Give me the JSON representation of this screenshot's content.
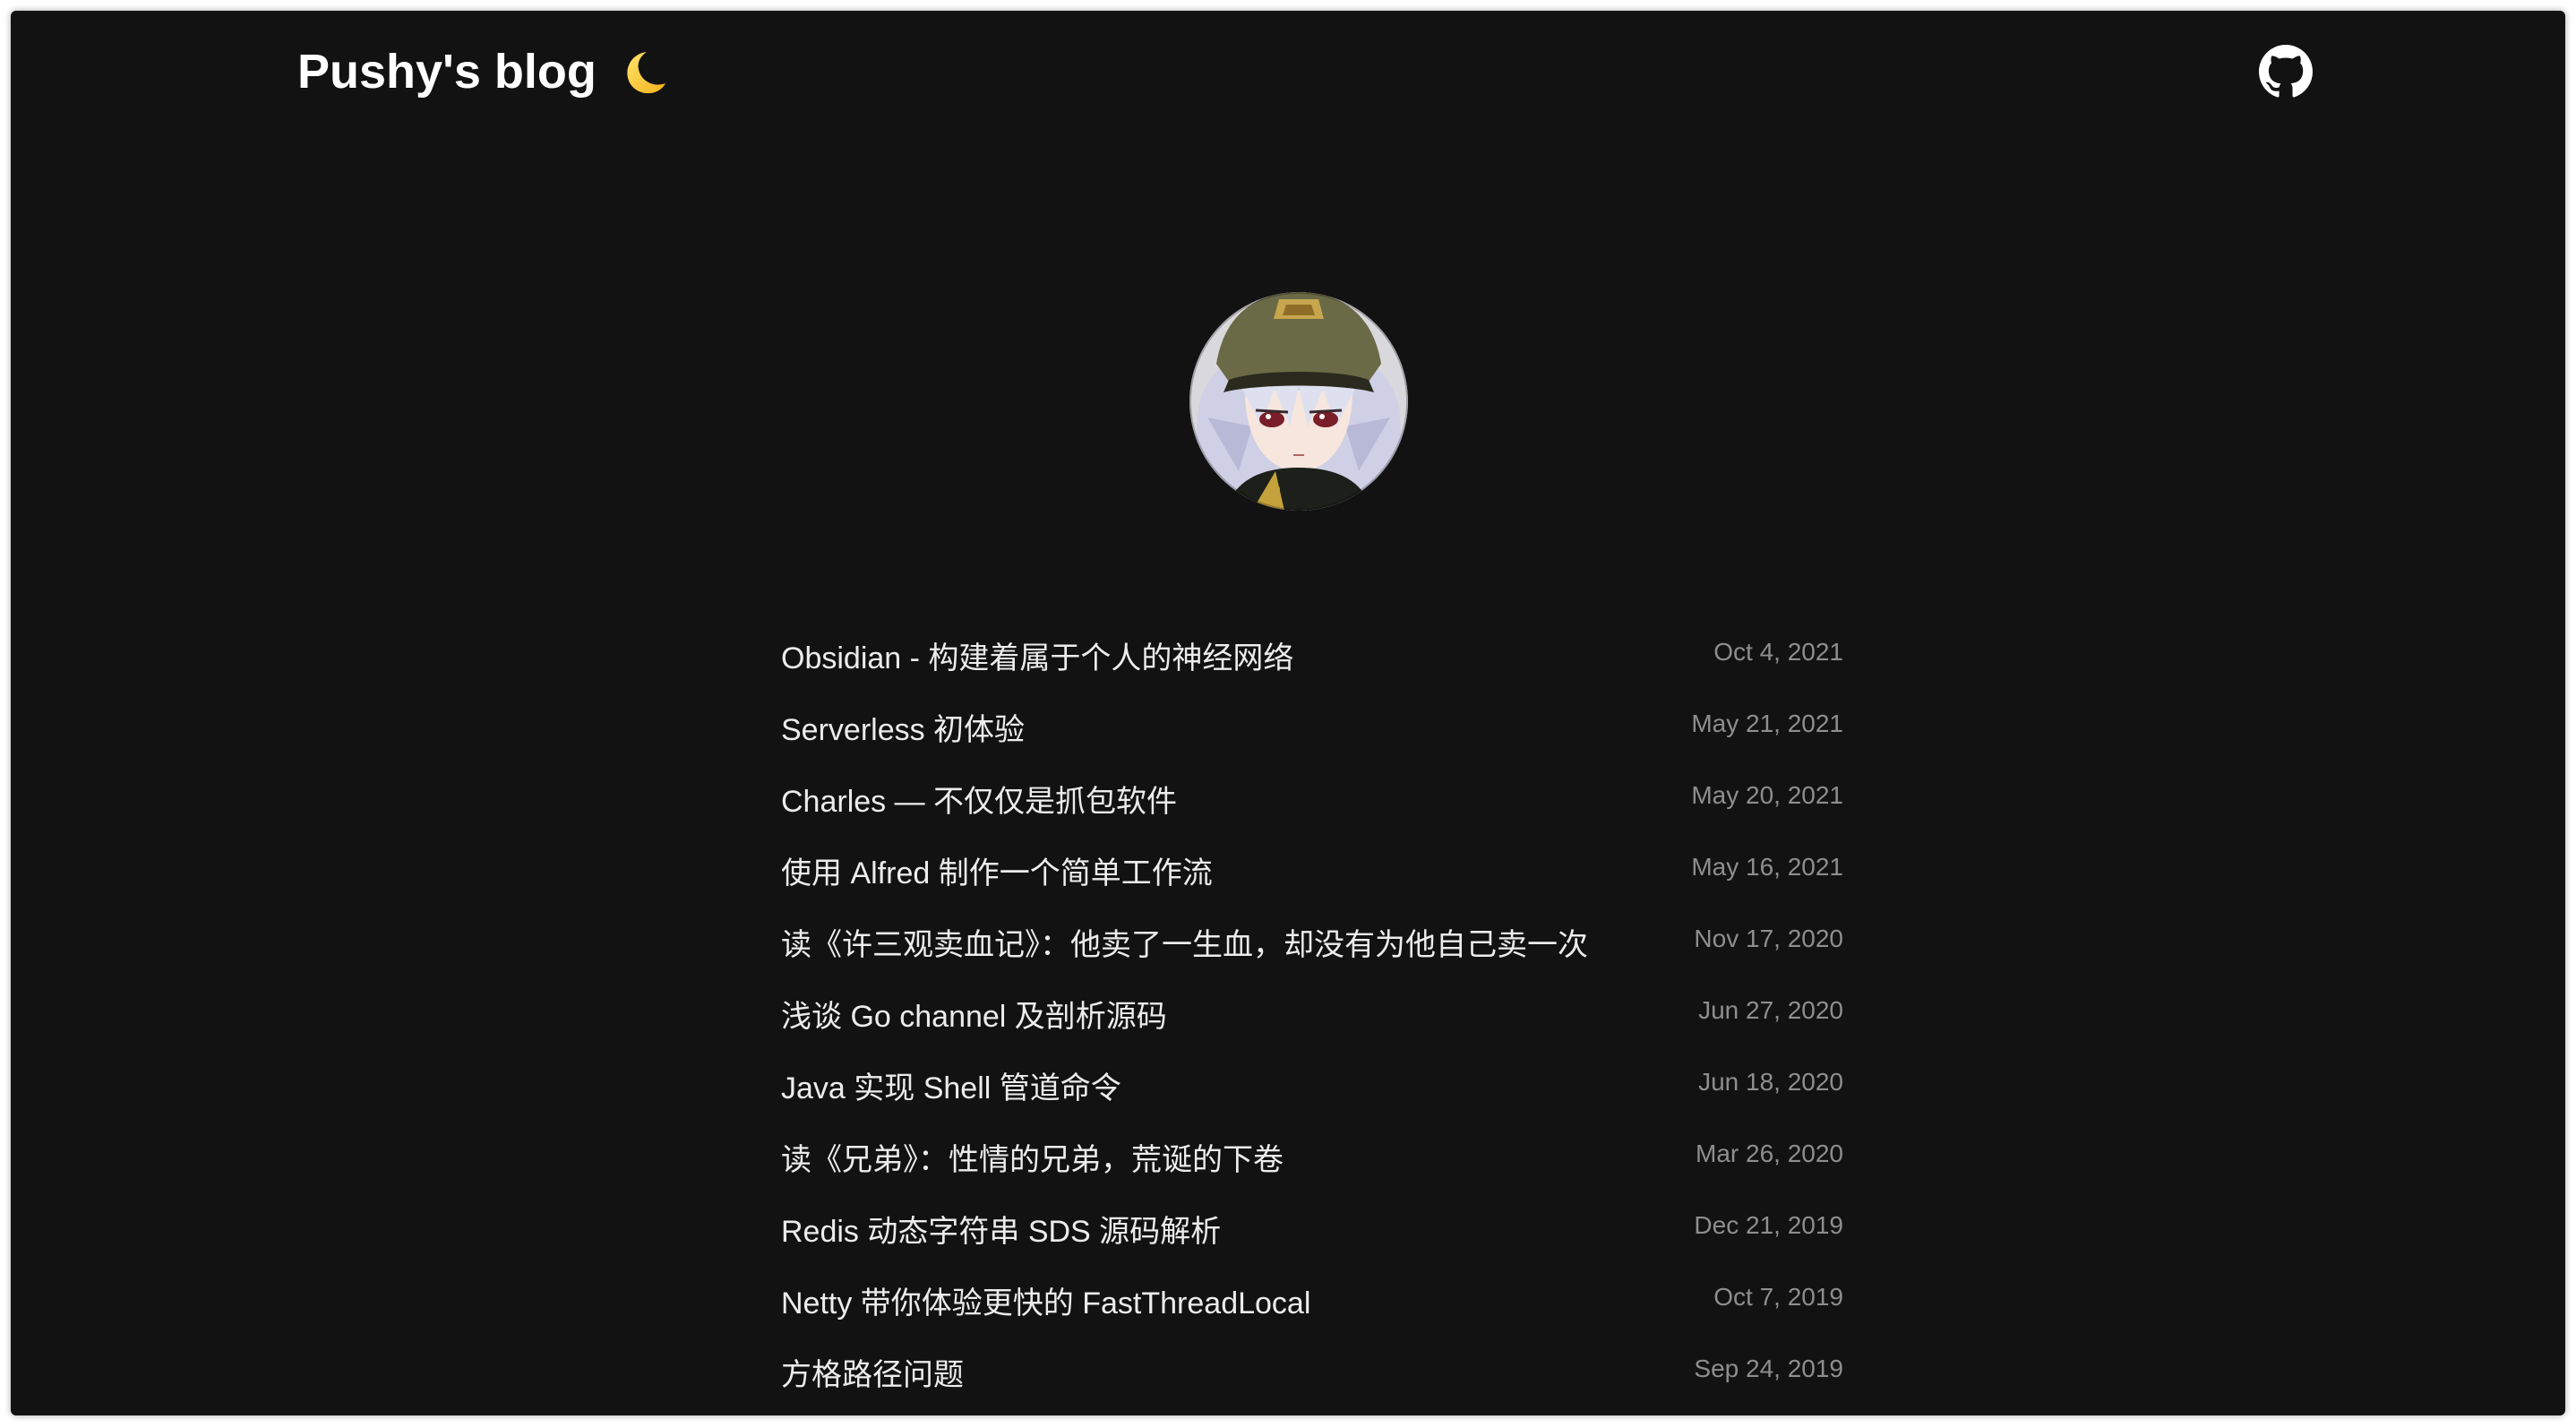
{
  "header": {
    "site_title": "Pushy's blog",
    "theme_icon": "moon-icon",
    "github_icon": "github-icon"
  },
  "avatar": {
    "alt": "avatar"
  },
  "posts": [
    {
      "title": "Obsidian - 构建着属于个人的神经网络",
      "date": "Oct 4, 2021"
    },
    {
      "title": "Serverless 初体验",
      "date": "May 21, 2021"
    },
    {
      "title": "Charles — 不仅仅是抓包软件",
      "date": "May 20, 2021"
    },
    {
      "title": "使用 Alfred 制作一个简单工作流",
      "date": "May 16, 2021"
    },
    {
      "title": "读《许三观卖血记》：他卖了一生血，却没有为他自己卖一次",
      "date": "Nov 17, 2020"
    },
    {
      "title": "浅谈 Go channel 及剖析源码",
      "date": "Jun 27, 2020"
    },
    {
      "title": "Java 实现 Shell 管道命令",
      "date": "Jun 18, 2020"
    },
    {
      "title": "读《兄弟》：性情的兄弟，荒诞的下卷",
      "date": "Mar 26, 2020"
    },
    {
      "title": "Redis 动态字符串 SDS 源码解析",
      "date": "Dec 21, 2019"
    },
    {
      "title": "Netty 带你体验更快的 FastThreadLocal",
      "date": "Oct 7, 2019"
    },
    {
      "title": "方格路径问题",
      "date": "Sep 24, 2019"
    }
  ]
}
